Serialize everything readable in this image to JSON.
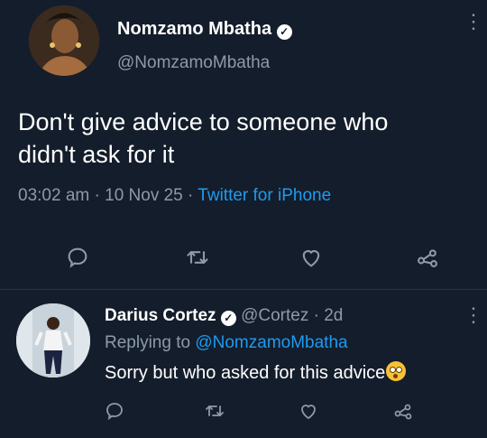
{
  "tweet": {
    "author_name": "Nomzamo Mbatha",
    "author_handle": "@NomzamoMbatha",
    "text_line1": "Don't give advice to someone who",
    "text_line2": "didn't ask for it",
    "time": "03:02 am",
    "date": "10 Nov 25",
    "source": "Twitter for iPhone",
    "sep": "·"
  },
  "reply": {
    "author_name": "Darius Cortez",
    "author_handle": "@Cortez",
    "age": "2d",
    "replying_to_label": "Replying to",
    "replying_to_handle": "@NomzamoMbatha",
    "text": "Sorry but who asked for this advice",
    "sep": "·"
  },
  "icons": {
    "verified": "checkmark-badge-icon",
    "reply": "comment-icon",
    "retweet": "retweet-icon",
    "like": "heart-icon",
    "share": "share-icon",
    "more": "vertical-dots-icon",
    "emoji": "flushed-face-emoji"
  },
  "colors": {
    "background": "#141d2b",
    "text": "#ffffff",
    "secondary": "#8d9aa8",
    "link": "#1d9bf0"
  }
}
